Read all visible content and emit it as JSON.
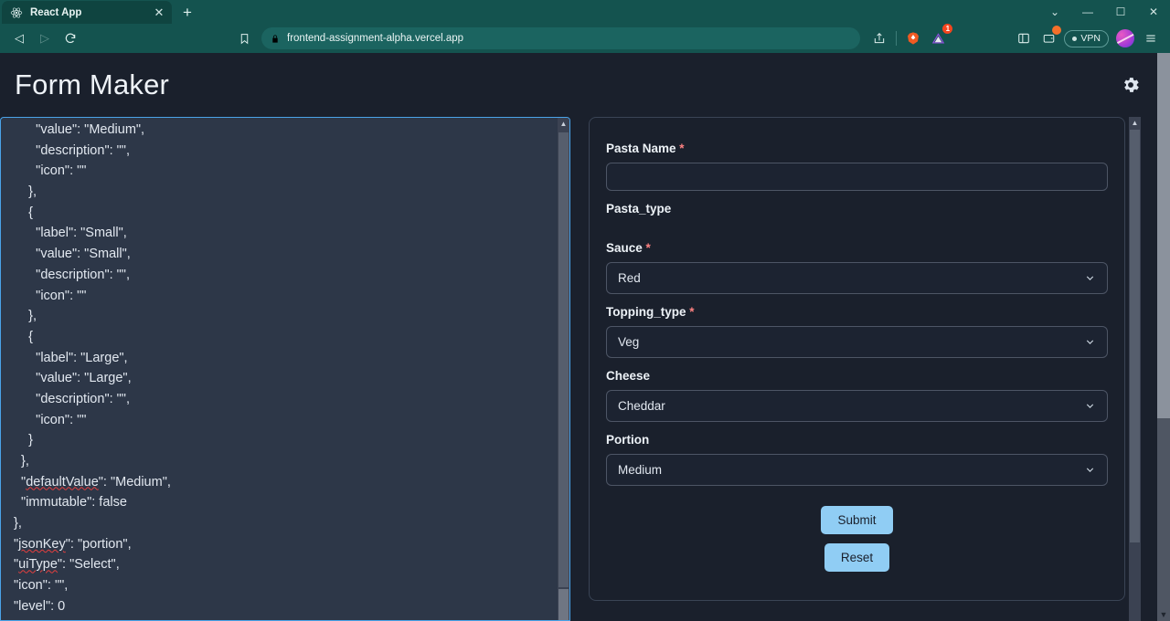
{
  "browser": {
    "tab": {
      "title": "React App",
      "favicon_icon": "react-atom-icon",
      "close_icon": "close-icon"
    },
    "new_tab_icon": "plus-icon",
    "window_controls": [
      {
        "name": "tab-search",
        "icon": "chevron-down-icon",
        "glyph": "⌄"
      },
      {
        "name": "minimize",
        "icon": "minimize-icon",
        "glyph": "—"
      },
      {
        "name": "maximize",
        "icon": "maximize-icon",
        "glyph": "☐"
      },
      {
        "name": "close",
        "icon": "close-icon",
        "glyph": "✕"
      }
    ],
    "nav": {
      "back_icon": "back-arrow-icon",
      "forward_icon": "forward-arrow-icon",
      "reload_icon": "reload-icon",
      "bookmark_icon": "bookmark-icon"
    },
    "omnibox": {
      "lock_icon": "lock-icon",
      "url": "frontend-assignment-alpha.vercel.app"
    },
    "toolbar_right": {
      "share_icon": "share-icon",
      "brave_shield_icon": "brave-lion-icon",
      "extension_icon": "extension-icon",
      "extension_badge": "1",
      "sidebar_icon": "sidebar-panel-icon",
      "wallet_icon": "brave-wallet-icon",
      "vpn_label": "VPN",
      "profile_icon": "profile-avatar",
      "menu_icon": "hamburger-menu-icon"
    }
  },
  "app": {
    "title": "Form Maker",
    "settings_icon": "gear-icon"
  },
  "editor": {
    "name": "json-schema-editor",
    "lines": [
      {
        "text": "      \"value\": \"Medium\","
      },
      {
        "text": "      \"description\": \"\","
      },
      {
        "text": "      \"icon\": \"\""
      },
      {
        "text": "    },"
      },
      {
        "text": "    {"
      },
      {
        "text": "      \"label\": \"Small\","
      },
      {
        "text": "      \"value\": \"Small\","
      },
      {
        "text": "      \"description\": \"\","
      },
      {
        "text": "      \"icon\": \"\""
      },
      {
        "text": "    },"
      },
      {
        "text": "    {"
      },
      {
        "text": "      \"label\": \"Large\","
      },
      {
        "text": "      \"value\": \"Large\","
      },
      {
        "text": "      \"description\": \"\","
      },
      {
        "text": "      \"icon\": \"\""
      },
      {
        "text": "    }"
      },
      {
        "text": "  },"
      },
      {
        "text": "  \"defaultValue\": \"Medium\",",
        "spell": "defaultValue"
      },
      {
        "text": "  \"immutable\": false"
      },
      {
        "text": "},"
      },
      {
        "text": "\"jsonKey\": \"portion\",",
        "spell": "jsonKey"
      },
      {
        "text": "\"uiType\": \"Select\",",
        "spell": "uiType"
      },
      {
        "text": "\"icon\": \"\","
      },
      {
        "text": "\"level\": 0"
      }
    ],
    "scroll_up_arrow": "scroll-up-arrow"
  },
  "form": {
    "name": "generated-form",
    "fields": [
      {
        "label": "Pasta Name",
        "required": true,
        "type": "text",
        "value": "",
        "placeholder": ""
      },
      {
        "label": "Pasta_type",
        "required": false,
        "type": "label-only"
      },
      {
        "label": "Sauce",
        "required": true,
        "type": "select",
        "value": "Red"
      },
      {
        "label": "Topping_type",
        "required": true,
        "type": "select",
        "value": "Veg"
      },
      {
        "label": "Cheese",
        "required": false,
        "type": "select",
        "value": "Cheddar"
      },
      {
        "label": "Portion",
        "required": false,
        "type": "select",
        "value": "Medium"
      }
    ],
    "submit_label": "Submit",
    "reset_label": "Reset",
    "required_marker": "*",
    "chevron_icon": "chevron-down-icon"
  },
  "colors": {
    "page_bg": "#1a202c",
    "editor_bg": "#2d3748",
    "editor_border": "#4aa3e8",
    "accent_button": "#90cdf4",
    "required_red": "#fc8181",
    "browser_chrome": "#14534f",
    "spellcheck_red": "#e53e3e"
  }
}
